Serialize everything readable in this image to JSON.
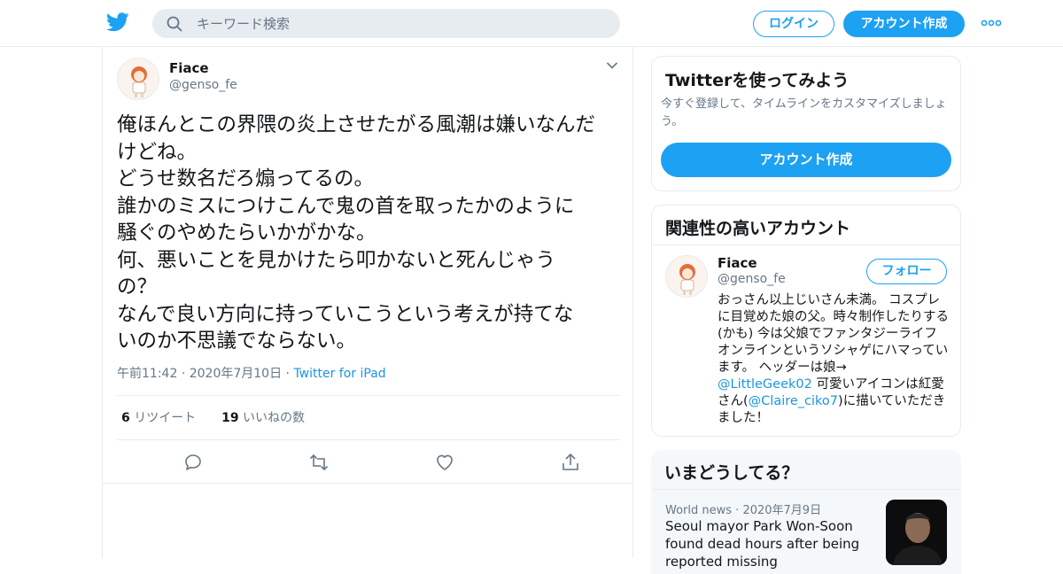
{
  "header": {
    "search_placeholder": "キーワード検索",
    "login_label": "ログイン",
    "signup_label": "アカウント作成",
    "brand_color": "#1da1f2"
  },
  "tweet": {
    "author_name": "Fiace",
    "author_handle": "@genso_fe",
    "text": "俺ほんとこの界隈の炎上させたがる風潮は嫌いなんだ\nけどね。\nどうせ数名だろ煽ってるの。\n誰かのミスにつけこんで鬼の首を取ったかのように\n騒ぐのやめたらいかがかな。\n何、悪いことを見かけたら叩かないと死んじゃう\nの？\nなんで良い方向に持っていこうという考えが持てな\nいのか不思議でならない。",
    "time": "午前11:42",
    "date": "2020年7月10日",
    "via": "Twitter for iPad",
    "retweet_count": "6",
    "retweet_label": "リツイート",
    "like_count": "19",
    "like_label": "いいねの数"
  },
  "sidebar": {
    "signup_card": {
      "title": "Twitterを使ってみよう",
      "subtitle": "今すぐ登録して、タイムラインをカスタマイズしましょう。",
      "cta_label": "アカウント作成"
    },
    "related_card": {
      "title": "関連性の高いアカウント",
      "name": "Fiace",
      "handle": "@genso_fe",
      "follow_label": "フォロー",
      "bio_part1": "おっさん以上じいさん未満。 コスプレに目覚めた娘の父。時々制作したりする(かも) 今は父娘でファンタジーライフオンラインというソシャゲにハマっています。 ヘッダーは娘→",
      "bio_link1": "@LittleGeek02",
      "bio_part2": " 可愛いアイコンは紅愛さん(",
      "bio_link2": "@Claire_ciko7",
      "bio_part3": ")に描いていただきました！"
    },
    "trends_card": {
      "title": "いまどうしてる？",
      "category": "World news",
      "date": "2020年7月9日",
      "headline": "Seoul mayor Park Won-Soon found dead hours after being reported missing"
    }
  }
}
